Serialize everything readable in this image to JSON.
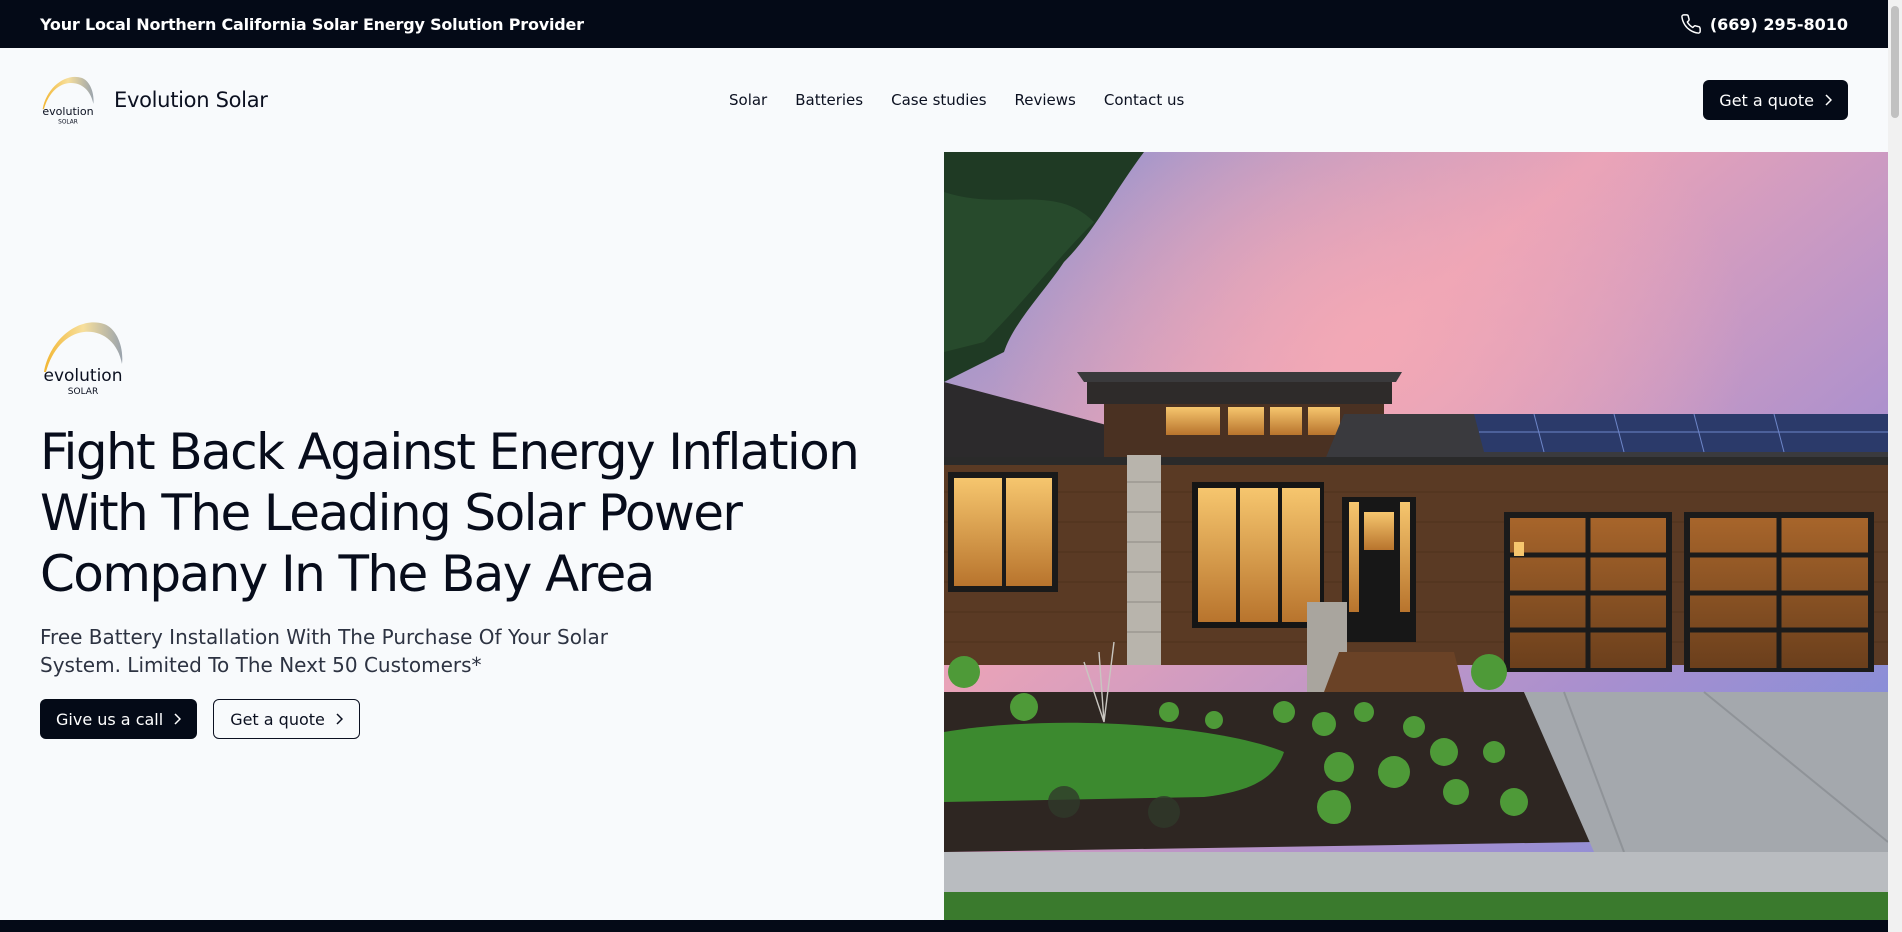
{
  "topbar": {
    "tagline": "Your Local Northern California Solar Energy Solution Provider",
    "phone": "(669) 295-8010",
    "phone_icon": "phone-icon"
  },
  "nav": {
    "brand_name": "Evolution Solar",
    "logo_word": "evolution",
    "logo_sub": "SOLAR",
    "items": [
      "Solar",
      "Batteries",
      "Case studies",
      "Reviews",
      "Contact us"
    ],
    "quote_label": "Get a quote"
  },
  "hero": {
    "logo_word": "evolution",
    "logo_sub": "SOLAR",
    "title": "Fight Back Against Energy Inflation With The Leading Solar Power Company In The Bay Area",
    "subtitle": "Free Battery Installation With The Purchase Of Your Solar System. Limited To The Next 50 Customers*",
    "call_label": "Give us a call",
    "quote_label": "Get a quote"
  },
  "colors": {
    "dark": "#040a17",
    "background": "#f8fafc",
    "logo_gold": "#f2b632",
    "logo_silver": "#9aa3ad"
  }
}
